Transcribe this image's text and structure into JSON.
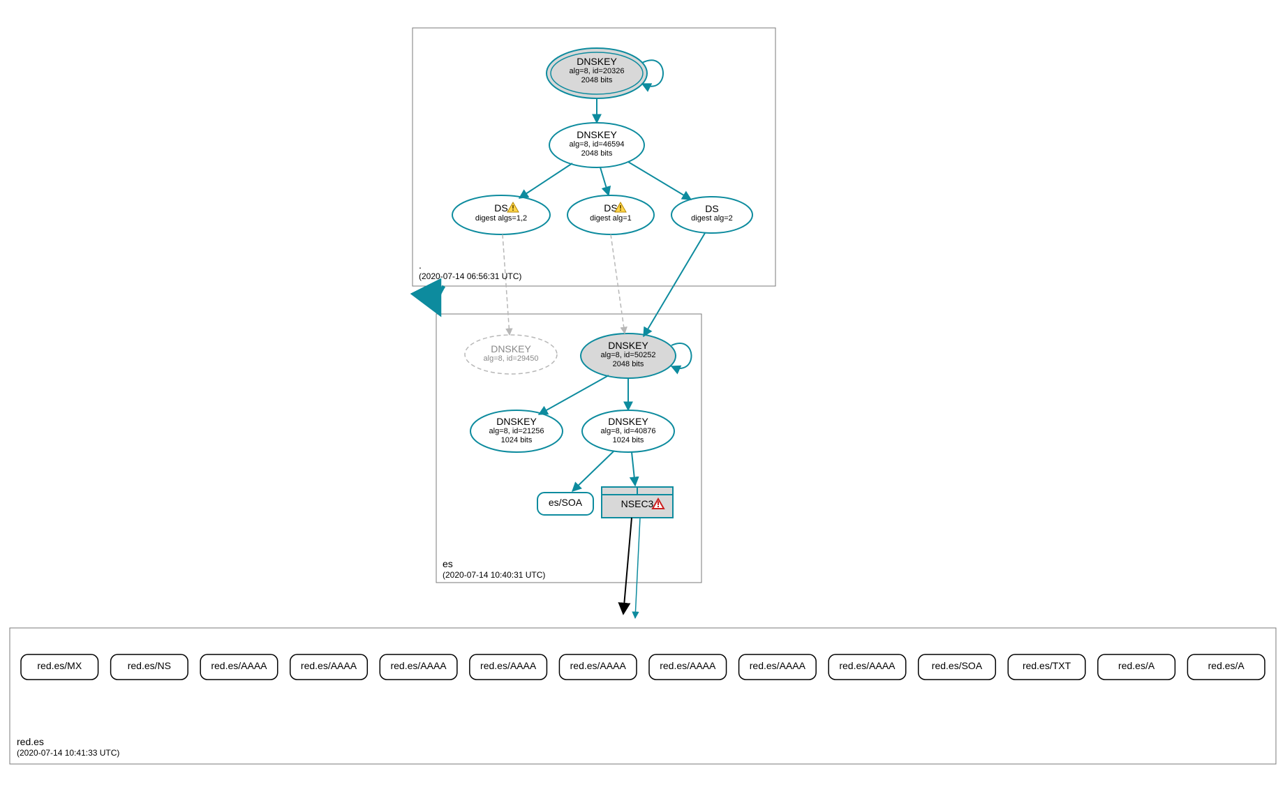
{
  "zones": {
    "root": {
      "label": ".",
      "timestamp": "(2020-07-14 06:56:31 UTC)"
    },
    "es": {
      "label": "es",
      "timestamp": "(2020-07-14 10:40:31 UTC)"
    },
    "redes": {
      "label": "red.es",
      "timestamp": "(2020-07-14 10:41:33 UTC)"
    }
  },
  "nodes": {
    "root_ksk": {
      "title": "DNSKEY",
      "sub1": "alg=8, id=20326",
      "sub2": "2048 bits"
    },
    "root_zsk": {
      "title": "DNSKEY",
      "sub1": "alg=8, id=46594",
      "sub2": "2048 bits"
    },
    "ds1": {
      "title": "DS",
      "sub1": "digest algs=1,2"
    },
    "ds2": {
      "title": "DS",
      "sub1": "digest alg=1"
    },
    "ds3": {
      "title": "DS",
      "sub1": "digest alg=2"
    },
    "es_dnskey_missing": {
      "title": "DNSKEY",
      "sub1": "alg=8, id=29450"
    },
    "es_ksk": {
      "title": "DNSKEY",
      "sub1": "alg=8, id=50252",
      "sub2": "2048 bits"
    },
    "es_zsk1": {
      "title": "DNSKEY",
      "sub1": "alg=8, id=21256",
      "sub2": "1024 bits"
    },
    "es_zsk2": {
      "title": "DNSKEY",
      "sub1": "alg=8, id=40876",
      "sub2": "1024 bits"
    },
    "es_soa": {
      "title": "es/SOA"
    },
    "nsec3": {
      "title": "NSEC3"
    }
  },
  "rrsets": [
    "red.es/MX",
    "red.es/NS",
    "red.es/AAAA",
    "red.es/AAAA",
    "red.es/AAAA",
    "red.es/AAAA",
    "red.es/AAAA",
    "red.es/AAAA",
    "red.es/AAAA",
    "red.es/AAAA",
    "red.es/SOA",
    "red.es/TXT",
    "red.es/A",
    "red.es/A"
  ],
  "colors": {
    "teal": "#0d8b9e",
    "grayFill": "#d8d8d8",
    "grayStroke": "#b7b7b7",
    "black": "#000000"
  }
}
